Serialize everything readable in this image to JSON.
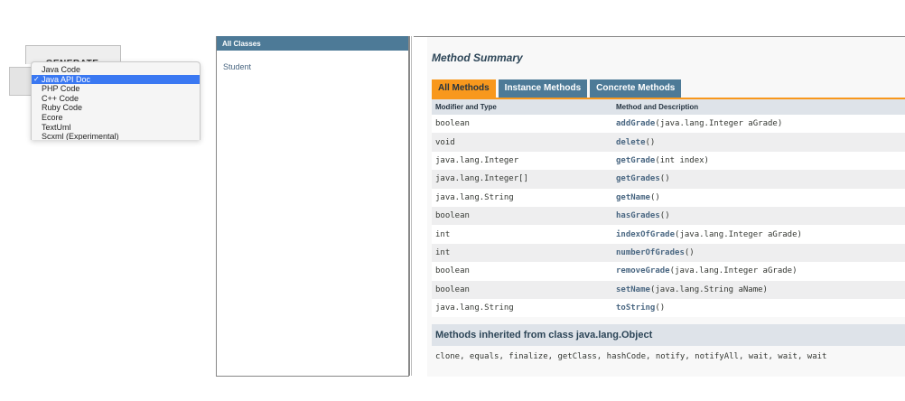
{
  "generator": {
    "button_label": "GENERATE",
    "languages": [
      "Java Code",
      "Java API Doc",
      "PHP Code",
      "C++ Code",
      "Ruby Code",
      "Ecore",
      "TextUml",
      "Scxml (Experimental)"
    ],
    "selected_language": "Java API Doc",
    "check_glyph": "✓"
  },
  "class_frame": {
    "header": "All Classes",
    "classes": [
      "Student"
    ]
  },
  "method_summary": {
    "title": "Method Summary",
    "tabs": [
      "All Methods",
      "Instance Methods",
      "Concrete Methods"
    ],
    "active_tab": "All Methods",
    "columns": [
      "Modifier and Type",
      "Method and Description"
    ],
    "rows": [
      {
        "type": "boolean",
        "name": "addGrade",
        "params": "(java.lang.Integer aGrade)"
      },
      {
        "type": "void",
        "name": "delete",
        "params": "()"
      },
      {
        "type": "java.lang.Integer",
        "name": "getGrade",
        "params": "(int index)"
      },
      {
        "type": "java.lang.Integer[]",
        "name": "getGrades",
        "params": "()"
      },
      {
        "type": "java.lang.String",
        "name": "getName",
        "params": "()"
      },
      {
        "type": "boolean",
        "name": "hasGrades",
        "params": "()"
      },
      {
        "type": "int",
        "name": "indexOfGrade",
        "params": "(java.lang.Integer aGrade)"
      },
      {
        "type": "int",
        "name": "numberOfGrades",
        "params": "()"
      },
      {
        "type": "boolean",
        "name": "removeGrade",
        "params": "(java.lang.Integer aGrade)"
      },
      {
        "type": "boolean",
        "name": "setName",
        "params": "(java.lang.String aName)"
      },
      {
        "type": "java.lang.String",
        "name": "toString",
        "params": "()"
      }
    ]
  },
  "inherited": {
    "title": "Methods inherited from class java.lang.Object",
    "methods": "clone, equals, finalize, getClass, hashCode, notify, notifyAll, wait, wait, wait"
  },
  "colors": {
    "header_blue": "#4d7a97",
    "tab_orange": "#f8981d",
    "link_blue": "#4a6782",
    "row_alt": "#eeeeef",
    "section_header": "#dee3e9",
    "dropdown_selected": "#3a78f2"
  }
}
